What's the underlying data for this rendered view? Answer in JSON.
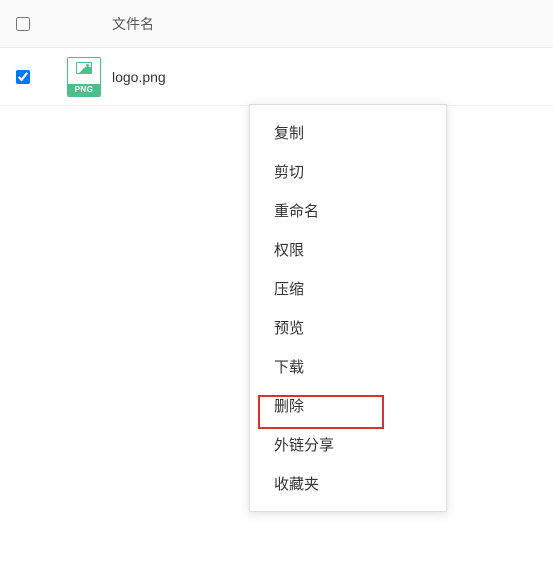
{
  "table": {
    "header": {
      "column_name_label": "文件名"
    },
    "rows": [
      {
        "checked": true,
        "icon_badge": "PNG",
        "filename": "logo.png"
      }
    ]
  },
  "context_menu": {
    "items": [
      {
        "label": "复制"
      },
      {
        "label": "剪切"
      },
      {
        "label": "重命名"
      },
      {
        "label": "权限"
      },
      {
        "label": "压缩"
      },
      {
        "label": "预览"
      },
      {
        "label": "下载"
      },
      {
        "label": "删除"
      },
      {
        "label": "外链分享",
        "highlighted": true
      },
      {
        "label": "收藏夹"
      }
    ]
  }
}
